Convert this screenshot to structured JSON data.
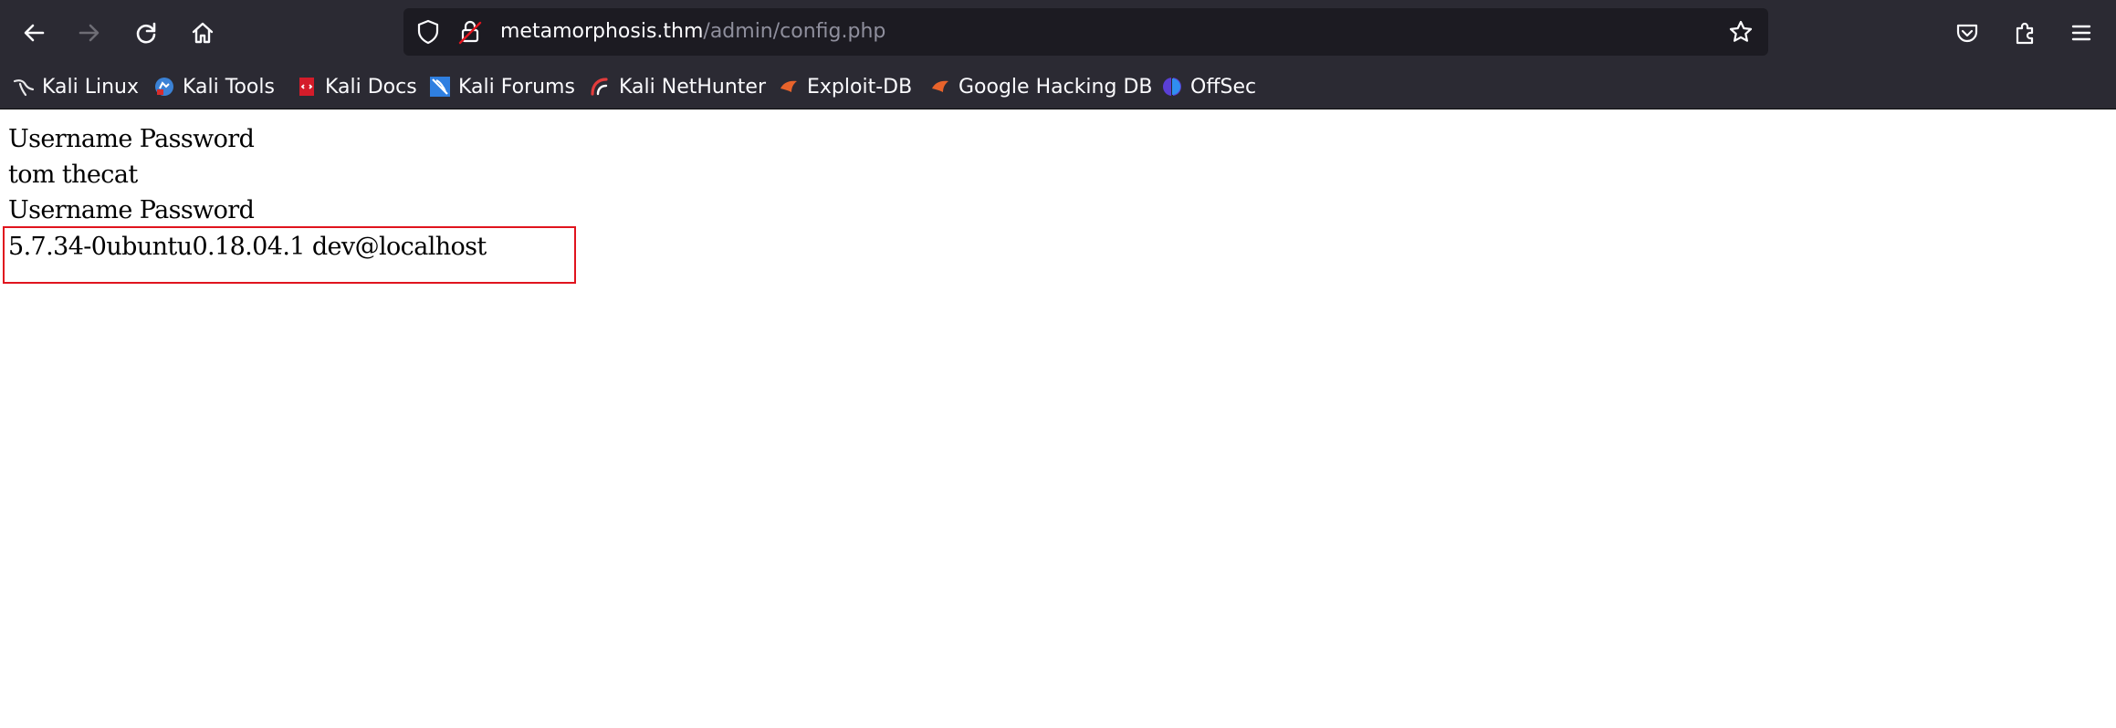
{
  "browser": {
    "url_host": "metamorphosis.thm",
    "url_path": "/admin/config.php",
    "accent": "#e0141e",
    "toolbar_color": "#2b2a33"
  },
  "bookmarks": [
    {
      "label": "Kali Linux",
      "icon": "kali-dragon-icon"
    },
    {
      "label": "Kali Tools",
      "icon": "kali-tools-icon"
    },
    {
      "label": "Kali Docs",
      "icon": "kali-docs-icon"
    },
    {
      "label": "Kali Forums",
      "icon": "kali-forums-icon"
    },
    {
      "label": "Kali NetHunter",
      "icon": "kali-nethunter-icon"
    },
    {
      "label": "Exploit-DB",
      "icon": "exploit-db-icon"
    },
    {
      "label": "Google Hacking DB",
      "icon": "ghdb-icon"
    },
    {
      "label": "OffSec",
      "icon": "offsec-icon"
    }
  ],
  "page": {
    "lines": [
      "Username Password",
      "tom thecat",
      "Username Password",
      "5.7.34-0ubuntu0.18.04.1 dev@localhost"
    ]
  }
}
